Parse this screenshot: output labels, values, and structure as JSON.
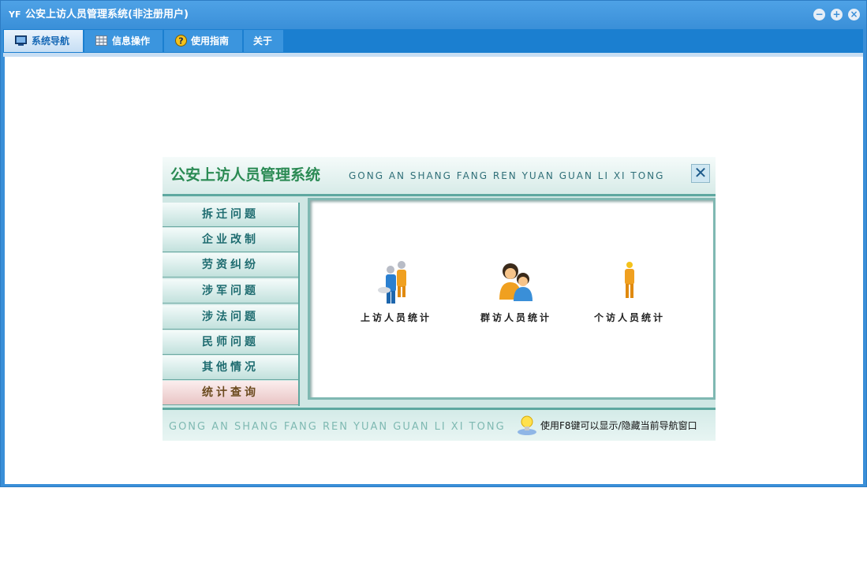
{
  "window": {
    "app_icon": "app-logo-icon",
    "app_icon_glyph": "YF",
    "title": "公安上访人员管理系统(非注册用户)",
    "controls": [
      "minimize-icon",
      "maximize-icon",
      "close-icon"
    ]
  },
  "tabs": [
    {
      "label": "系统导航",
      "icon": "monitor-icon",
      "active": true
    },
    {
      "label": "信息操作",
      "icon": "grid-icon",
      "active": false
    },
    {
      "label": "使用指南",
      "icon": "help-icon",
      "active": false
    },
    {
      "label": "关于",
      "icon": "",
      "active": false
    }
  ],
  "nav": {
    "title": "公安上访人员管理系统",
    "pinyin": "GONG AN SHANG FANG REN YUAN GUAN LI XI TONG",
    "close_glyph": "✕",
    "menu": [
      {
        "label": "拆迁问题",
        "active": false
      },
      {
        "label": "企业改制",
        "active": false
      },
      {
        "label": "劳资纠纷",
        "active": false
      },
      {
        "label": "涉军问题",
        "active": false
      },
      {
        "label": "涉法问题",
        "active": false
      },
      {
        "label": "民师问题",
        "active": false
      },
      {
        "label": "其他情况",
        "active": false
      },
      {
        "label": "统计查询",
        "active": true
      }
    ],
    "stats": [
      {
        "label": "上访人员统计",
        "icon": "group-people-icon"
      },
      {
        "label": "群访人员统计",
        "icon": "couple-people-icon"
      },
      {
        "label": "个访人员统计",
        "icon": "single-person-icon"
      }
    ],
    "footer_pinyin": "GONG AN SHANG FANG REN YUAN GUAN LI XI TONG",
    "hint_icon": "lightbulb-icon",
    "hint": "使用F8键可以显示/隐藏当前导航窗口"
  },
  "colors": {
    "titlebar": "#3a8fd8",
    "tabbar": "#1b7fd0",
    "nav_title": "#2a8a53",
    "menu_text": "#1e6c70",
    "menu_active_bg": "#e9c5c5"
  }
}
